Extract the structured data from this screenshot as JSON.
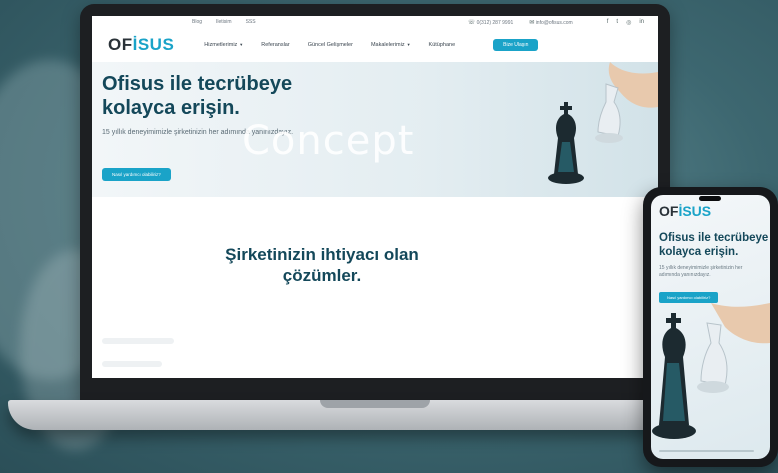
{
  "laptop": {
    "topbar": {
      "links": [
        "Blog",
        "Iletisim",
        "SSS"
      ],
      "phone": "0(312) 287 9991",
      "email": "info@ofisus.com",
      "social_icons": [
        "facebook-icon",
        "twitter-icon",
        "instagram-icon",
        "linkedin-icon"
      ]
    },
    "logo": {
      "prefix": "OF",
      "accent": "İSUS"
    },
    "menu": [
      {
        "label": "Hizmetlerimiz",
        "dropdown": true
      },
      {
        "label": "Referanslar",
        "dropdown": false
      },
      {
        "label": "Güncel Gelişmeler",
        "dropdown": false
      },
      {
        "label": "Makalelerimiz",
        "dropdown": true
      },
      {
        "label": "Kütüphane",
        "dropdown": false
      }
    ],
    "cta": "Bize Ulaşın",
    "hero": {
      "title_line1": "Ofisus ile tecrübeye",
      "title_line2": "kolayca erişin.",
      "subtitle": "15 yıllık deneyimimizle şirketinizin her adımında yanınızdayız.",
      "button": "Nasıl yardımcı olabiliriz?"
    },
    "section": {
      "title_line1": "Şirketinizin ihtiyacı olan",
      "title_line2": "çözümler."
    }
  },
  "watermark": "Concept",
  "phone": {
    "logo": {
      "prefix": "OF",
      "accent": "İSUS"
    },
    "title_line1": "Ofisus ile tecrübeye",
    "title_line2": "kolayca erişin.",
    "subtitle": "15 yıllık deneyimimizle şirketinizin her adımında yanınızdayız.",
    "button": "Nasıl yardımcı olabiliriz?"
  },
  "colors": {
    "accent": "#1aa3c8",
    "heading": "#14485a",
    "background": "#3d6770"
  }
}
